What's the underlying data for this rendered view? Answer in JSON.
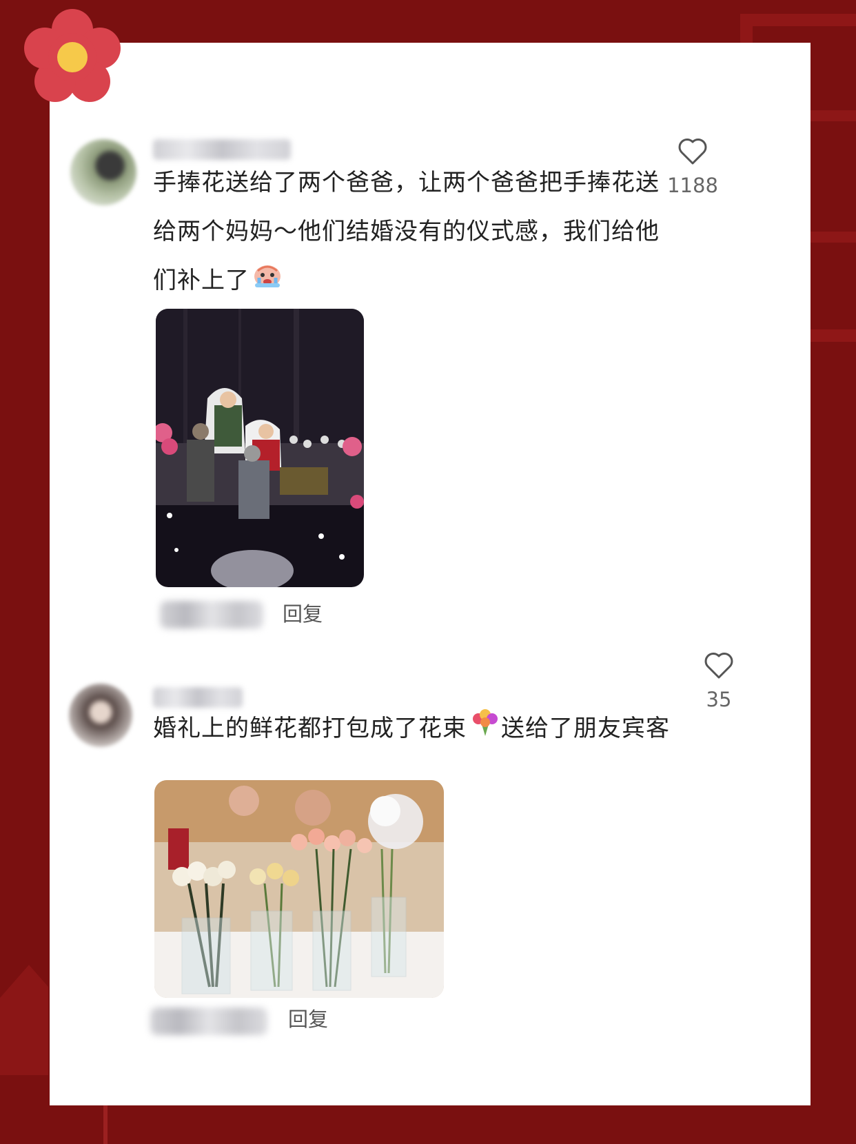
{
  "comments": [
    {
      "text_lines": [
        "手捧花送给了两个爸爸，让两个爸爸把手捧花送",
        "给两个妈妈～他们结婚没有的仪式感，我们给他",
        "们补上了"
      ],
      "likes": "1188",
      "reply_label": "回复",
      "emoji": "crying-face-emoji",
      "photo": "wedding-ceremony-photo"
    },
    {
      "text_before_emoji": "婚礼上的鲜花都打包成了花束",
      "text_after_emoji": "送给了朋友宾客",
      "likes": "35",
      "reply_label": "回复",
      "emoji": "bouquet-emoji",
      "photo": "flower-vases-photo"
    }
  ],
  "colors": {
    "background": "#7a1010",
    "card": "#ffffff",
    "text": "#222222",
    "muted": "#666666"
  }
}
